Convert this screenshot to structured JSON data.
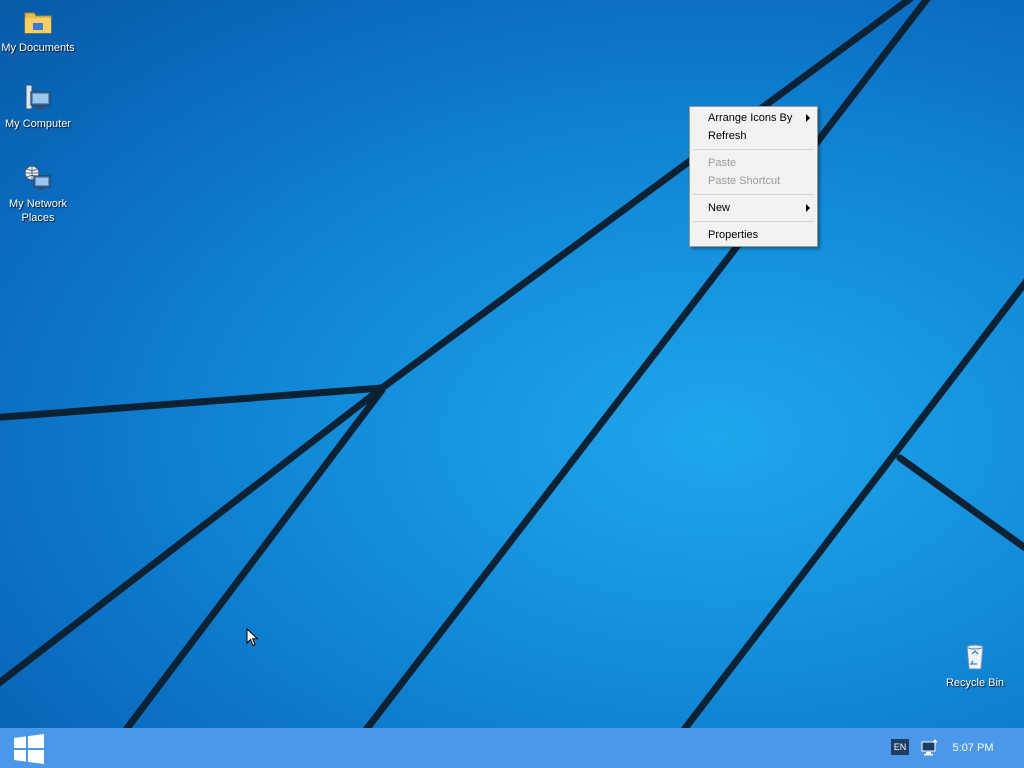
{
  "desktop": {
    "icons": [
      {
        "label": "My Documents",
        "icon": "folder-documents-icon"
      },
      {
        "label": "My Computer",
        "icon": "computer-icon"
      },
      {
        "label": "My Network Places",
        "icon": "network-places-icon"
      },
      {
        "label": "Recycle Bin",
        "icon": "recycle-bin-icon"
      }
    ],
    "background_color": "#128ad8"
  },
  "context_menu": {
    "items": [
      {
        "label": "Arrange Icons By",
        "enabled": true,
        "submenu": true
      },
      {
        "label": "Refresh",
        "enabled": true,
        "submenu": false
      },
      {
        "label": "Paste",
        "enabled": false,
        "submenu": false
      },
      {
        "label": "Paste Shortcut",
        "enabled": false,
        "submenu": false
      },
      {
        "label": "New",
        "enabled": true,
        "submenu": true
      },
      {
        "label": "Properties",
        "enabled": true,
        "submenu": false
      }
    ]
  },
  "taskbar": {
    "start_icon": "windows-logo-icon",
    "tray": {
      "language": "EN",
      "network_icon": "network-monitor-icon",
      "clock": "5:07 PM"
    },
    "background_color": "#4b97ea"
  }
}
